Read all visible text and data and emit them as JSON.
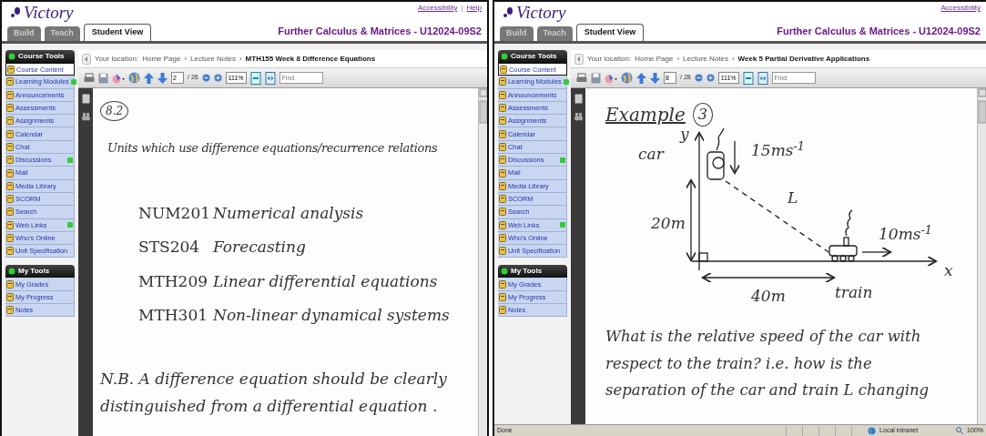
{
  "panels": [
    {
      "logo": "Victory",
      "links": [
        "Accessibility",
        "Help"
      ],
      "link_separator": "|",
      "tabs": [
        {
          "label": "Build",
          "selected": false
        },
        {
          "label": "Teach",
          "selected": false
        },
        {
          "label": "Student View",
          "selected": true
        }
      ],
      "course_title": "Further Calculus & Matrices - U12024-09S2",
      "sidebar": [
        {
          "heading": "Course Tools",
          "items": [
            {
              "label": "Course Content",
              "selected": true,
              "new": false
            },
            {
              "label": "Learning Modules",
              "selected": false,
              "new": true
            },
            {
              "label": "Announcements",
              "selected": false,
              "new": false
            },
            {
              "label": "Assessments",
              "selected": false,
              "new": false
            },
            {
              "label": "Assignments",
              "selected": false,
              "new": false
            },
            {
              "label": "Calendar",
              "selected": false,
              "new": false
            },
            {
              "label": "Chat",
              "selected": false,
              "new": false
            },
            {
              "label": "Discussions",
              "selected": false,
              "new": true
            },
            {
              "label": "Mail",
              "selected": false,
              "new": false
            },
            {
              "label": "Media Library",
              "selected": false,
              "new": false
            },
            {
              "label": "SCORM",
              "selected": false,
              "new": false
            },
            {
              "label": "Search",
              "selected": false,
              "new": false
            },
            {
              "label": "Web Links",
              "selected": false,
              "new": true
            },
            {
              "label": "Who's Online",
              "selected": false,
              "new": false
            },
            {
              "label": "Unit Specification",
              "selected": false,
              "new": false
            }
          ]
        },
        {
          "heading": "My Tools",
          "items": [
            {
              "label": "My Grades",
              "selected": false,
              "new": false
            },
            {
              "label": "My Progress",
              "selected": false,
              "new": false
            },
            {
              "label": "Notes",
              "selected": false,
              "new": false
            }
          ]
        }
      ],
      "breadcrumb": {
        "label": "Your location:",
        "links": [
          "Home Page",
          "Lecture Notes"
        ],
        "separators": [
          "›",
          "›"
        ],
        "current": "MTH155 Week 8 Difference Equations"
      },
      "toolbar": {
        "page": "2",
        "pages": "/ 26",
        "zoom": "111%",
        "find_placeholder": "Find"
      },
      "document": {
        "kind": "list",
        "section": "8.2",
        "heading": "Units which use difference equations/recurrence relations",
        "rows": [
          {
            "code": "NUM201",
            "title": "Numerical analysis"
          },
          {
            "code": "STS204",
            "title": "Forecasting"
          },
          {
            "code": "MTH209",
            "title": "Linear differential equations"
          },
          {
            "code": "MTH301",
            "title": "Non-linear dynamical systems"
          }
        ],
        "note": "N.B. A difference equation should be clearly distinguished from a differential equation ."
      }
    },
    {
      "logo": "Victory",
      "links": [
        "Accessibility"
      ],
      "tabs": [
        {
          "label": "Build",
          "selected": false
        },
        {
          "label": "Teach",
          "selected": false
        },
        {
          "label": "Student View",
          "selected": true
        }
      ],
      "course_title": "Further Calculus & Matrices - U12024-09S2",
      "sidebar": [
        {
          "heading": "Course Tools",
          "items": [
            {
              "label": "Course Content",
              "selected": true,
              "new": false
            },
            {
              "label": "Learning Modules",
              "selected": false,
              "new": true
            },
            {
              "label": "Announcements",
              "selected": false,
              "new": false
            },
            {
              "label": "Assessments",
              "selected": false,
              "new": false
            },
            {
              "label": "Assignments",
              "selected": false,
              "new": false
            },
            {
              "label": "Calendar",
              "selected": false,
              "new": false
            },
            {
              "label": "Chat",
              "selected": false,
              "new": false
            },
            {
              "label": "Discussions",
              "selected": false,
              "new": true
            },
            {
              "label": "Mail",
              "selected": false,
              "new": false
            },
            {
              "label": "Media Library",
              "selected": false,
              "new": false
            },
            {
              "label": "SCORM",
              "selected": false,
              "new": false
            },
            {
              "label": "Search",
              "selected": false,
              "new": false
            },
            {
              "label": "Web Links",
              "selected": false,
              "new": true
            },
            {
              "label": "Who's Online",
              "selected": false,
              "new": false
            },
            {
              "label": "Unit Specification",
              "selected": false,
              "new": false
            }
          ]
        },
        {
          "heading": "My Tools",
          "items": [
            {
              "label": "My Grades",
              "selected": false,
              "new": false
            },
            {
              "label": "My Progress",
              "selected": false,
              "new": false
            },
            {
              "label": "Notes",
              "selected": false,
              "new": false
            }
          ]
        }
      ],
      "breadcrumb": {
        "label": "Your location:",
        "links": [
          "Home Page",
          "Lecture Notes"
        ],
        "separators": [
          "›",
          "›"
        ],
        "current": "Week 5 Partial Derivative Applications"
      },
      "toolbar": {
        "page": "8",
        "pages": "/ 28",
        "zoom": "111%",
        "find_placeholder": "Find"
      },
      "document": {
        "kind": "example",
        "title": "Example",
        "number": "3",
        "labels": [
          "y",
          "car",
          "15ms$^{-1}$",
          "L",
          "20m",
          "10ms$^{-1}$",
          "train",
          "40m",
          "x"
        ],
        "question": "What is the relative speed of the car with respect to the train? i.e. how is the separation of the car and train L changing"
      },
      "status_bar": {
        "text": "Done",
        "zone": "Local intranet",
        "zoom": "100%"
      }
    }
  ]
}
